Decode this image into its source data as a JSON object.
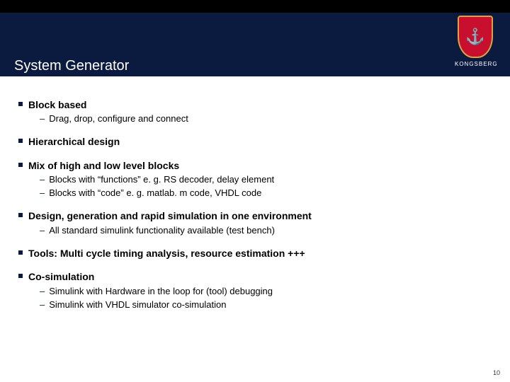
{
  "brand": "KONGSBERG",
  "title": "System Generator",
  "page_number": "10",
  "topics": [
    {
      "label": "Block based",
      "subs": [
        "Drag, drop, configure and connect"
      ]
    },
    {
      "label": "Hierarchical design",
      "subs": []
    },
    {
      "label": "Mix of high and low level blocks",
      "subs": [
        "Blocks with “functions” e. g. RS decoder, delay element",
        "Blocks with “code” e. g. matlab. m code, VHDL code"
      ]
    },
    {
      "label": "Design, generation and rapid simulation in one environment",
      "subs": [
        "All standard simulink functionality available (test bench)"
      ]
    },
    {
      "label": "Tools: Multi cycle timing analysis, resource estimation +++",
      "subs": []
    },
    {
      "label": "Co-simulation",
      "subs": [
        "Simulink with Hardware in the loop for (tool) debugging",
        "Simulink with VHDL simulator co-simulation"
      ]
    }
  ]
}
